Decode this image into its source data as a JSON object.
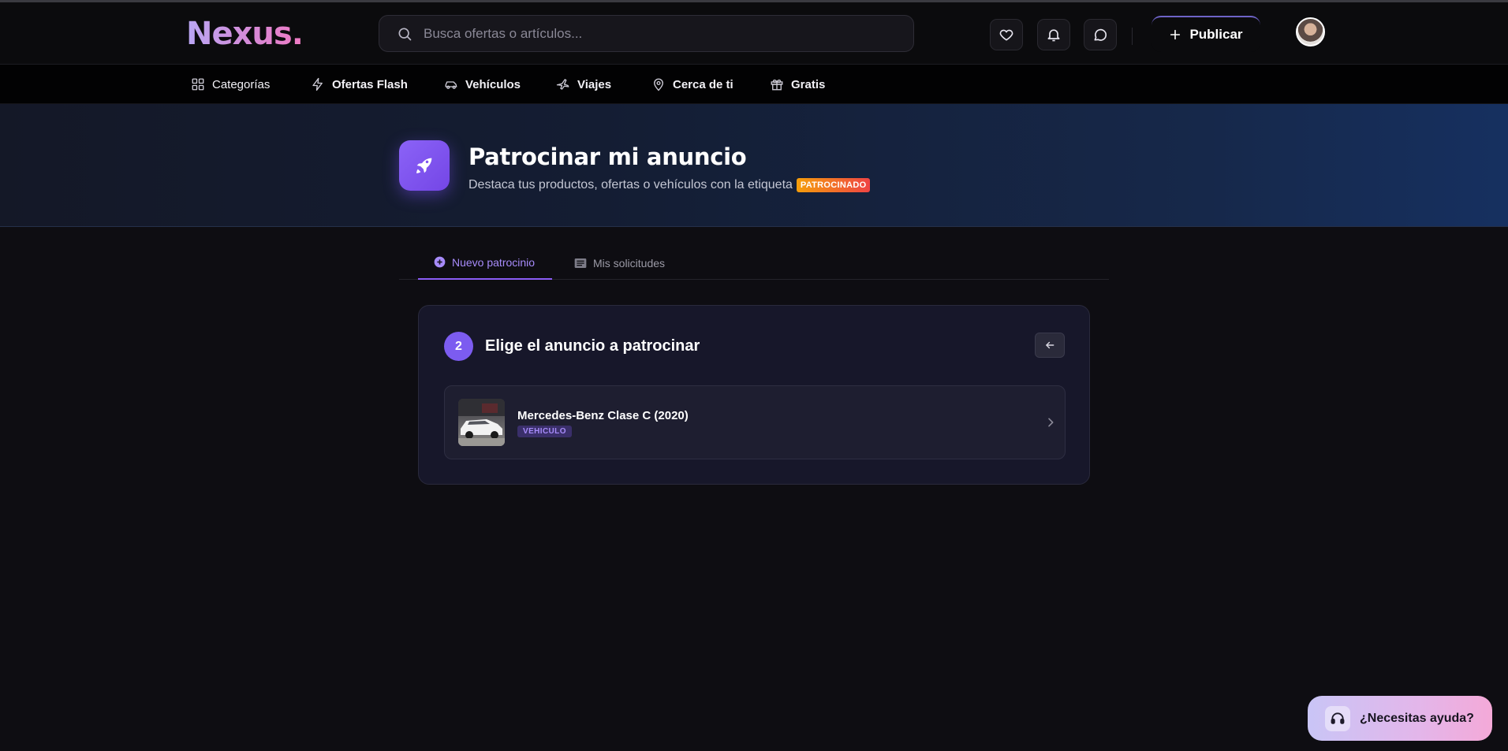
{
  "header": {
    "logo": "Nexus.",
    "search_placeholder": "Busca ofertas o artículos...",
    "publish_label": "Publicar"
  },
  "nav": {
    "items": [
      {
        "label": "Categorías",
        "icon": "grid-icon"
      },
      {
        "label": "Ofertas Flash",
        "icon": "lightning-icon"
      },
      {
        "label": "Vehículos",
        "icon": "car-icon"
      },
      {
        "label": "Viajes",
        "icon": "plane-icon"
      },
      {
        "label": "Cerca de ti",
        "icon": "location-pin-icon"
      },
      {
        "label": "Gratis",
        "icon": "gift-icon"
      }
    ]
  },
  "hero": {
    "title": "Patrocinar mi anuncio",
    "subtitle": "Destaca tus productos, ofertas o vehículos con la etiqueta",
    "badge": "PATROCINADO",
    "icon": "rocket-icon"
  },
  "tabs": [
    {
      "label": "Nuevo patrocinio",
      "active": true
    },
    {
      "label": "Mis solicitudes",
      "active": false
    }
  ],
  "step": {
    "number": "2",
    "title": "Elige el anuncio a patrocinar"
  },
  "listings": [
    {
      "title": "Mercedes-Benz Clase C (2020)",
      "type": "VEHICULO"
    }
  ],
  "help": {
    "label": "¿Necesitas ayuda?"
  },
  "colors": {
    "accent": "#8b5cf6",
    "background": "#0e0d12",
    "badge_gradient_start": "#f59e0b",
    "badge_gradient_end": "#ef4444"
  }
}
